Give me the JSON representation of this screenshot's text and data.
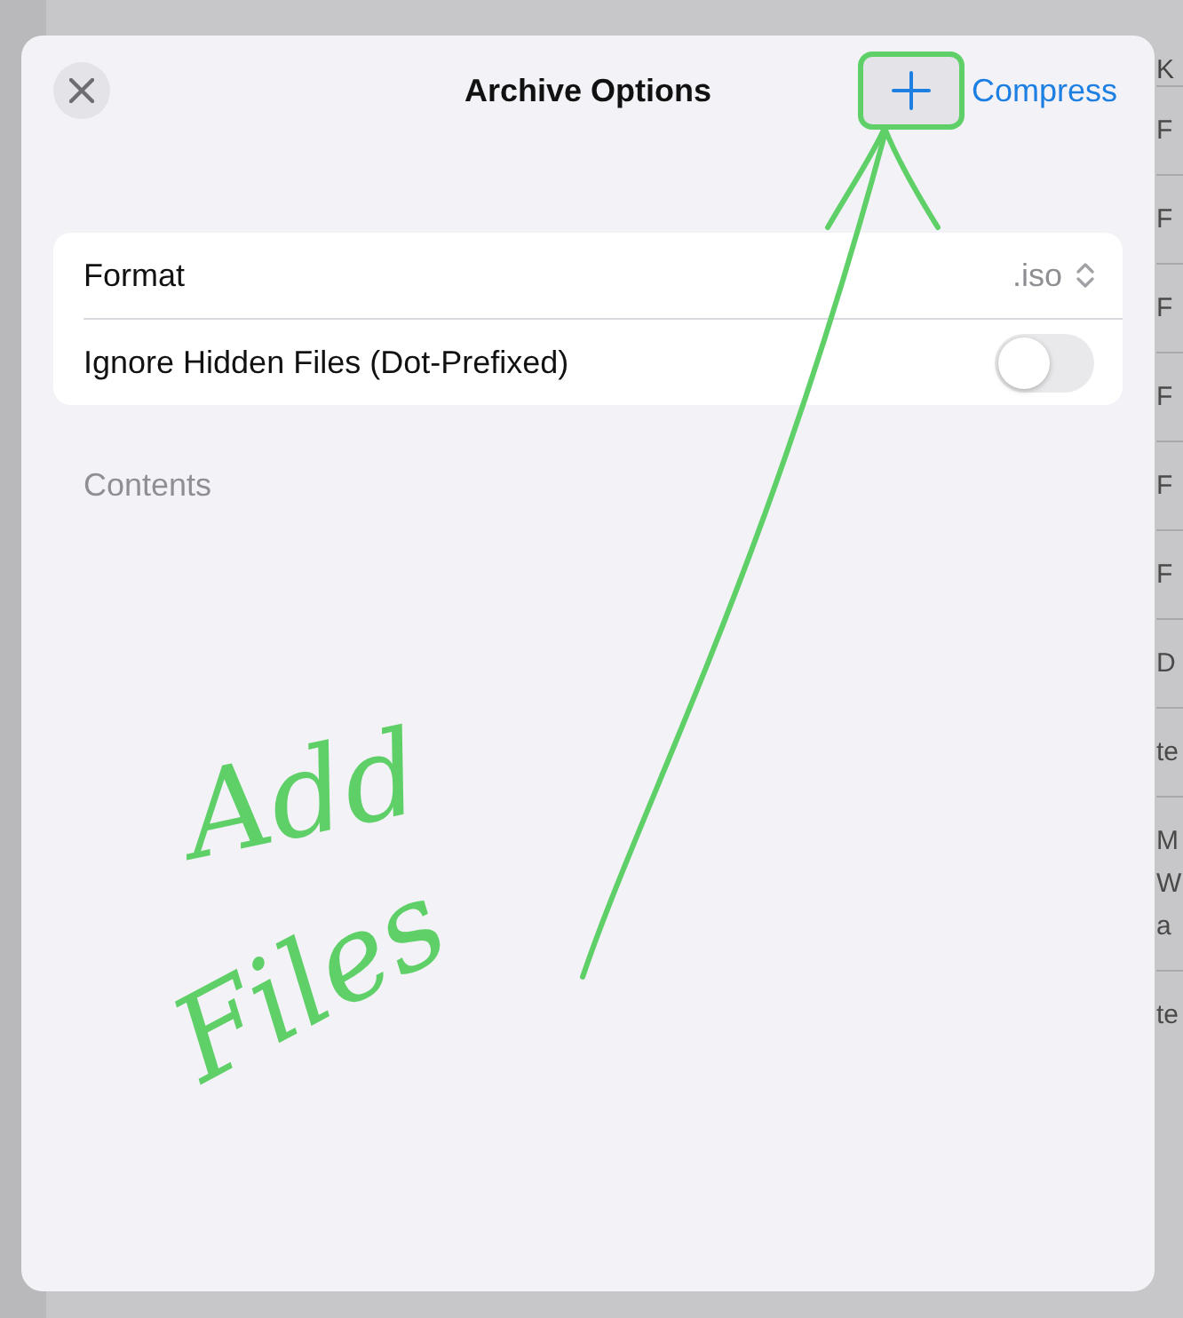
{
  "background": {
    "header": {
      "column_2": "K"
    },
    "rows": [
      {
        "lines": [
          "F"
        ]
      },
      {
        "lines": [
          "F"
        ]
      },
      {
        "lines": [
          "F"
        ]
      },
      {
        "lines": [
          "F"
        ]
      },
      {
        "lines": [
          "F"
        ]
      },
      {
        "lines": [
          "F"
        ]
      },
      {
        "lines": [
          "D"
        ]
      },
      {
        "lines": [
          "te"
        ]
      },
      {
        "lines": [
          "M",
          "W",
          "a"
        ]
      },
      {
        "lines": [
          "te"
        ]
      }
    ]
  },
  "sheet": {
    "title": "Archive Options",
    "action": "Compress",
    "settings": [
      {
        "kind": "picker",
        "label": "Format",
        "value": ".iso"
      },
      {
        "kind": "toggle",
        "label": "Ignore Hidden Files (Dot-Prefixed)",
        "on": false
      }
    ],
    "section": "Contents"
  },
  "annotation": {
    "lines": [
      "Add",
      "Files"
    ]
  }
}
